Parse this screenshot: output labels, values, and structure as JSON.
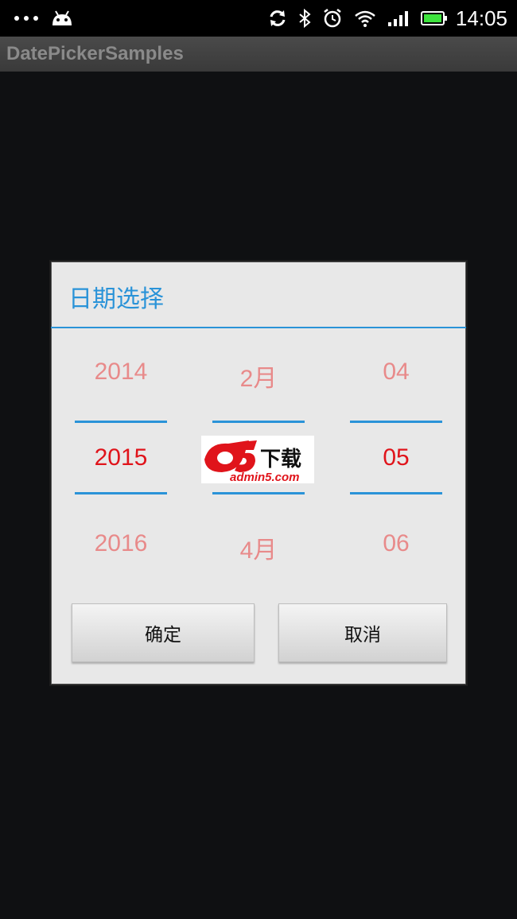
{
  "status_bar": {
    "time": "14:05",
    "icons": [
      "more-dots-icon",
      "android-icon",
      "sync-icon",
      "bluetooth-icon",
      "alarm-icon",
      "wifi-icon",
      "signal-icon",
      "battery-icon"
    ],
    "battery_color": "#3ee43e"
  },
  "app": {
    "title": "DatePickerSamples"
  },
  "dialog": {
    "title": "日期选择",
    "accent_color": "#2a93d8",
    "selected_color": "#e0141b",
    "faded_color": "#e88a8a",
    "year": {
      "prev": "2014",
      "selected": "2015",
      "next": "2016"
    },
    "month": {
      "prev": "2月",
      "next": "4月"
    },
    "day": {
      "prev": "04",
      "selected": "05",
      "next": "06"
    },
    "confirm_label": "确定",
    "cancel_label": "取消"
  },
  "watermark": {
    "brand": "a5下载",
    "domain": "admin5.com"
  }
}
